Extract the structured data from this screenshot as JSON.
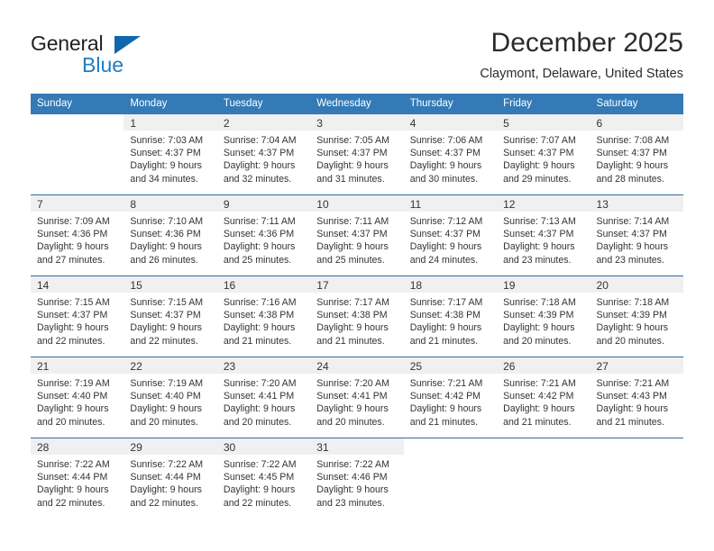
{
  "brand": {
    "name_top": "General",
    "name_bottom": "Blue",
    "triangle_icon": "triangle-icon",
    "color_dark": "#231f20",
    "color_blue": "#1f7dc4"
  },
  "header": {
    "title": "December 2025",
    "location": "Claymont, Delaware, United States"
  },
  "theme": {
    "header_blue": "#337ab7",
    "row_divider": "#2e6da4",
    "daynum_band": "#f0f0f0",
    "text": "#333333"
  },
  "weekday_headers": [
    "Sunday",
    "Monday",
    "Tuesday",
    "Wednesday",
    "Thursday",
    "Friday",
    "Saturday"
  ],
  "weeks": [
    [
      {
        "day": "",
        "sunrise": "",
        "sunset": "",
        "daylight_line1": "",
        "daylight_line2": "",
        "empty": true
      },
      {
        "day": "1",
        "sunrise": "Sunrise: 7:03 AM",
        "sunset": "Sunset: 4:37 PM",
        "daylight_line1": "Daylight: 9 hours",
        "daylight_line2": "and 34 minutes.",
        "empty": false
      },
      {
        "day": "2",
        "sunrise": "Sunrise: 7:04 AM",
        "sunset": "Sunset: 4:37 PM",
        "daylight_line1": "Daylight: 9 hours",
        "daylight_line2": "and 32 minutes.",
        "empty": false
      },
      {
        "day": "3",
        "sunrise": "Sunrise: 7:05 AM",
        "sunset": "Sunset: 4:37 PM",
        "daylight_line1": "Daylight: 9 hours",
        "daylight_line2": "and 31 minutes.",
        "empty": false
      },
      {
        "day": "4",
        "sunrise": "Sunrise: 7:06 AM",
        "sunset": "Sunset: 4:37 PM",
        "daylight_line1": "Daylight: 9 hours",
        "daylight_line2": "and 30 minutes.",
        "empty": false
      },
      {
        "day": "5",
        "sunrise": "Sunrise: 7:07 AM",
        "sunset": "Sunset: 4:37 PM",
        "daylight_line1": "Daylight: 9 hours",
        "daylight_line2": "and 29 minutes.",
        "empty": false
      },
      {
        "day": "6",
        "sunrise": "Sunrise: 7:08 AM",
        "sunset": "Sunset: 4:37 PM",
        "daylight_line1": "Daylight: 9 hours",
        "daylight_line2": "and 28 minutes.",
        "empty": false
      }
    ],
    [
      {
        "day": "7",
        "sunrise": "Sunrise: 7:09 AM",
        "sunset": "Sunset: 4:36 PM",
        "daylight_line1": "Daylight: 9 hours",
        "daylight_line2": "and 27 minutes.",
        "empty": false
      },
      {
        "day": "8",
        "sunrise": "Sunrise: 7:10 AM",
        "sunset": "Sunset: 4:36 PM",
        "daylight_line1": "Daylight: 9 hours",
        "daylight_line2": "and 26 minutes.",
        "empty": false
      },
      {
        "day": "9",
        "sunrise": "Sunrise: 7:11 AM",
        "sunset": "Sunset: 4:36 PM",
        "daylight_line1": "Daylight: 9 hours",
        "daylight_line2": "and 25 minutes.",
        "empty": false
      },
      {
        "day": "10",
        "sunrise": "Sunrise: 7:11 AM",
        "sunset": "Sunset: 4:37 PM",
        "daylight_line1": "Daylight: 9 hours",
        "daylight_line2": "and 25 minutes.",
        "empty": false
      },
      {
        "day": "11",
        "sunrise": "Sunrise: 7:12 AM",
        "sunset": "Sunset: 4:37 PM",
        "daylight_line1": "Daylight: 9 hours",
        "daylight_line2": "and 24 minutes.",
        "empty": false
      },
      {
        "day": "12",
        "sunrise": "Sunrise: 7:13 AM",
        "sunset": "Sunset: 4:37 PM",
        "daylight_line1": "Daylight: 9 hours",
        "daylight_line2": "and 23 minutes.",
        "empty": false
      },
      {
        "day": "13",
        "sunrise": "Sunrise: 7:14 AM",
        "sunset": "Sunset: 4:37 PM",
        "daylight_line1": "Daylight: 9 hours",
        "daylight_line2": "and 23 minutes.",
        "empty": false
      }
    ],
    [
      {
        "day": "14",
        "sunrise": "Sunrise: 7:15 AM",
        "sunset": "Sunset: 4:37 PM",
        "daylight_line1": "Daylight: 9 hours",
        "daylight_line2": "and 22 minutes.",
        "empty": false
      },
      {
        "day": "15",
        "sunrise": "Sunrise: 7:15 AM",
        "sunset": "Sunset: 4:37 PM",
        "daylight_line1": "Daylight: 9 hours",
        "daylight_line2": "and 22 minutes.",
        "empty": false
      },
      {
        "day": "16",
        "sunrise": "Sunrise: 7:16 AM",
        "sunset": "Sunset: 4:38 PM",
        "daylight_line1": "Daylight: 9 hours",
        "daylight_line2": "and 21 minutes.",
        "empty": false
      },
      {
        "day": "17",
        "sunrise": "Sunrise: 7:17 AM",
        "sunset": "Sunset: 4:38 PM",
        "daylight_line1": "Daylight: 9 hours",
        "daylight_line2": "and 21 minutes.",
        "empty": false
      },
      {
        "day": "18",
        "sunrise": "Sunrise: 7:17 AM",
        "sunset": "Sunset: 4:38 PM",
        "daylight_line1": "Daylight: 9 hours",
        "daylight_line2": "and 21 minutes.",
        "empty": false
      },
      {
        "day": "19",
        "sunrise": "Sunrise: 7:18 AM",
        "sunset": "Sunset: 4:39 PM",
        "daylight_line1": "Daylight: 9 hours",
        "daylight_line2": "and 20 minutes.",
        "empty": false
      },
      {
        "day": "20",
        "sunrise": "Sunrise: 7:18 AM",
        "sunset": "Sunset: 4:39 PM",
        "daylight_line1": "Daylight: 9 hours",
        "daylight_line2": "and 20 minutes.",
        "empty": false
      }
    ],
    [
      {
        "day": "21",
        "sunrise": "Sunrise: 7:19 AM",
        "sunset": "Sunset: 4:40 PM",
        "daylight_line1": "Daylight: 9 hours",
        "daylight_line2": "and 20 minutes.",
        "empty": false
      },
      {
        "day": "22",
        "sunrise": "Sunrise: 7:19 AM",
        "sunset": "Sunset: 4:40 PM",
        "daylight_line1": "Daylight: 9 hours",
        "daylight_line2": "and 20 minutes.",
        "empty": false
      },
      {
        "day": "23",
        "sunrise": "Sunrise: 7:20 AM",
        "sunset": "Sunset: 4:41 PM",
        "daylight_line1": "Daylight: 9 hours",
        "daylight_line2": "and 20 minutes.",
        "empty": false
      },
      {
        "day": "24",
        "sunrise": "Sunrise: 7:20 AM",
        "sunset": "Sunset: 4:41 PM",
        "daylight_line1": "Daylight: 9 hours",
        "daylight_line2": "and 20 minutes.",
        "empty": false
      },
      {
        "day": "25",
        "sunrise": "Sunrise: 7:21 AM",
        "sunset": "Sunset: 4:42 PM",
        "daylight_line1": "Daylight: 9 hours",
        "daylight_line2": "and 21 minutes.",
        "empty": false
      },
      {
        "day": "26",
        "sunrise": "Sunrise: 7:21 AM",
        "sunset": "Sunset: 4:42 PM",
        "daylight_line1": "Daylight: 9 hours",
        "daylight_line2": "and 21 minutes.",
        "empty": false
      },
      {
        "day": "27",
        "sunrise": "Sunrise: 7:21 AM",
        "sunset": "Sunset: 4:43 PM",
        "daylight_line1": "Daylight: 9 hours",
        "daylight_line2": "and 21 minutes.",
        "empty": false
      }
    ],
    [
      {
        "day": "28",
        "sunrise": "Sunrise: 7:22 AM",
        "sunset": "Sunset: 4:44 PM",
        "daylight_line1": "Daylight: 9 hours",
        "daylight_line2": "and 22 minutes.",
        "empty": false
      },
      {
        "day": "29",
        "sunrise": "Sunrise: 7:22 AM",
        "sunset": "Sunset: 4:44 PM",
        "daylight_line1": "Daylight: 9 hours",
        "daylight_line2": "and 22 minutes.",
        "empty": false
      },
      {
        "day": "30",
        "sunrise": "Sunrise: 7:22 AM",
        "sunset": "Sunset: 4:45 PM",
        "daylight_line1": "Daylight: 9 hours",
        "daylight_line2": "and 22 minutes.",
        "empty": false
      },
      {
        "day": "31",
        "sunrise": "Sunrise: 7:22 AM",
        "sunset": "Sunset: 4:46 PM",
        "daylight_line1": "Daylight: 9 hours",
        "daylight_line2": "and 23 minutes.",
        "empty": false
      },
      {
        "day": "",
        "sunrise": "",
        "sunset": "",
        "daylight_line1": "",
        "daylight_line2": "",
        "empty": true
      },
      {
        "day": "",
        "sunrise": "",
        "sunset": "",
        "daylight_line1": "",
        "daylight_line2": "",
        "empty": true
      },
      {
        "day": "",
        "sunrise": "",
        "sunset": "",
        "daylight_line1": "",
        "daylight_line2": "",
        "empty": true
      }
    ]
  ]
}
